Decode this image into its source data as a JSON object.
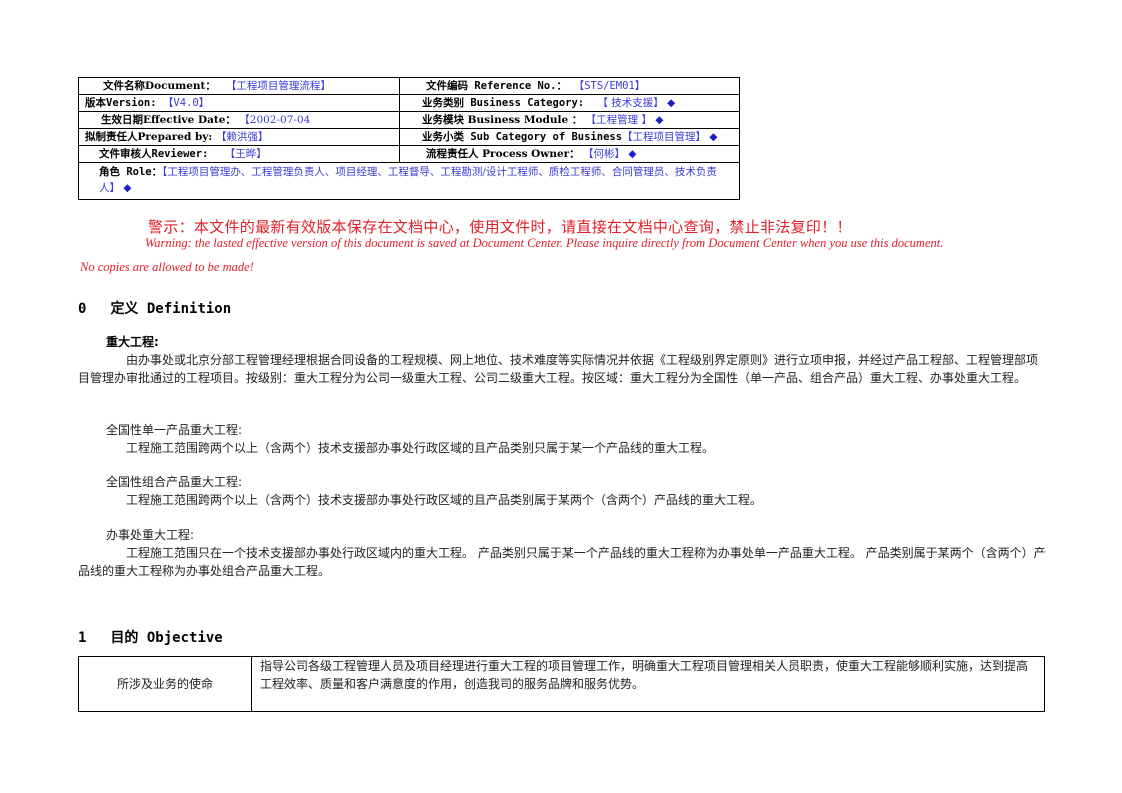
{
  "header_table": {
    "document_label": "文件名称Document：",
    "document_value": "【工程项目管理流程】",
    "reference_label": "文件编码 Reference No.：",
    "reference_value": "【STS/EM01】",
    "version_label": "版本Version: ",
    "version_value": "【V4.0】",
    "category_label": "业务类别 Business Category:",
    "category_value": "【 技术支援】",
    "effective_label": "生效日期Effective Date：",
    "effective_value": "【2002-07-04",
    "module_label": "业务模块 Business Module ：",
    "module_value": "【工程管理 】",
    "prepared_label": "拟制责任人Prepared by: ",
    "prepared_value": "【赖洪强】",
    "subcategory_label": "业务小类 Sub Category of Business",
    "subcategory_value": "【工程项目管理】",
    "reviewer_label": "文件审核人Reviewer: ",
    "reviewer_value": "【王晔】",
    "owner_label": "流程责任人 Process Owner：",
    "owner_value": "【何彬】",
    "role_label": "角色 Role：",
    "role_value": "【工程项目管理办、工程管理负责人、项目经理、工程督导、工程勘测/设计工程师、质检工程师、合同管理员、技术负责人】",
    "diamond": "◆"
  },
  "warning": {
    "cn": "警示：本文件的最新有效版本保存在文档中心，使用文件时，请直接在文档中心查询，禁止非法复印！！",
    "en_line1": "Warning: the lasted effective version of this document is saved at Document Center. Please inquire directly from Document Center when you use this document.",
    "en_line2": "No copies are allowed to be made!"
  },
  "section0": {
    "number": "0",
    "title": "定义 Definition",
    "term_heading": "重大工程:",
    "term_text": "由办事处或北京分部工程管理经理根据合同设备的工程规模、网上地位、技术难度等实际情况并依据《工程级别界定原则》进行立项申报，并经过产品工程部、工程管理部项目管理办审批通过的工程项目。按级别：重大工程分为公司一级重大工程、公司二级重大工程。按区域：重大工程分为全国性（单一产品、组合产品）重大工程、办事处重大工程。",
    "subs": [
      {
        "heading": "全国性单一产品重大工程:",
        "text": "工程施工范围跨两个以上（含两个）技术支援部办事处行政区域的且产品类别只属于某一个产品线的重大工程。"
      },
      {
        "heading": "全国性组合产品重大工程:",
        "text": "工程施工范围跨两个以上（含两个）技术支援部办事处行政区域的且产品类别属于某两个（含两个）产品线的重大工程。"
      },
      {
        "heading": "办事处重大工程:",
        "text": "工程施工范围只在一个技术支援部办事处行政区域内的重大工程。 产品类别只属于某一个产品线的重大工程称为办事处单一产品重大工程。 产品类别属于某两个（含两个）产品线的重大工程称为办事处组合产品重大工程。"
      }
    ]
  },
  "section1": {
    "number": "1",
    "title": "目的 Objective",
    "table": {
      "key": "所涉及业务的使命",
      "value": "指导公司各级工程管理人员及项目经理进行重大工程的项目管理工作，明确重大工程项目管理相关人员职责，使重大工程能够顺利实施，达到提高工程效率、质量和客户满意度的作用，创造我司的服务品牌和服务优势。"
    }
  }
}
